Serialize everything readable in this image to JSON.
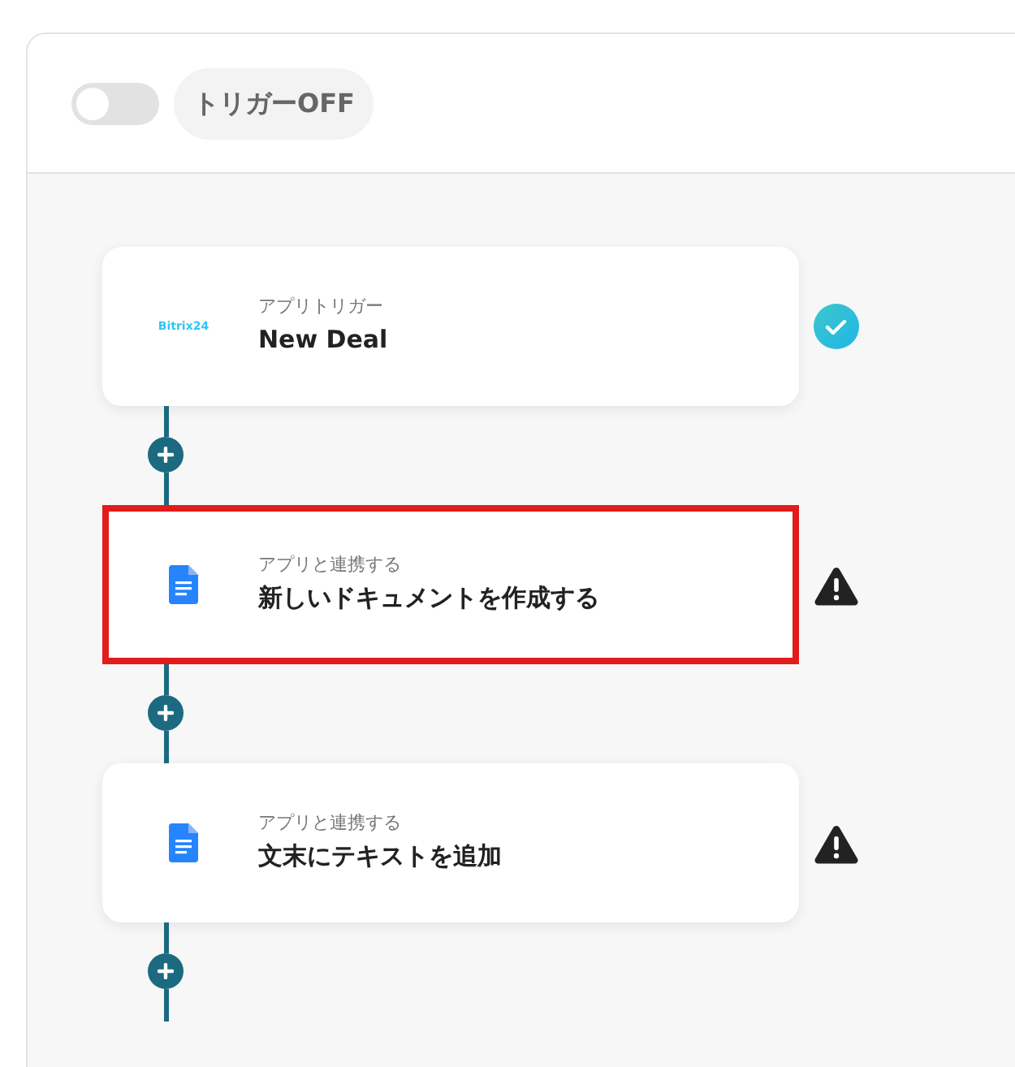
{
  "trigger": {
    "on": false,
    "label": "トリガーOFF"
  },
  "steps": [
    {
      "kind": "bitrix",
      "logo_text": "Bitrix24",
      "subtitle": "アプリトリガー",
      "title": "New Deal",
      "configured": true,
      "highlighted": false
    },
    {
      "kind": "docs",
      "subtitle": "アプリと連携する",
      "title": "新しいドキュメントを作成する",
      "configured": false,
      "highlighted": true
    },
    {
      "kind": "docs",
      "subtitle": "アプリと連携する",
      "title": "文末にテキストを追加",
      "configured": false,
      "highlighted": false
    }
  ]
}
